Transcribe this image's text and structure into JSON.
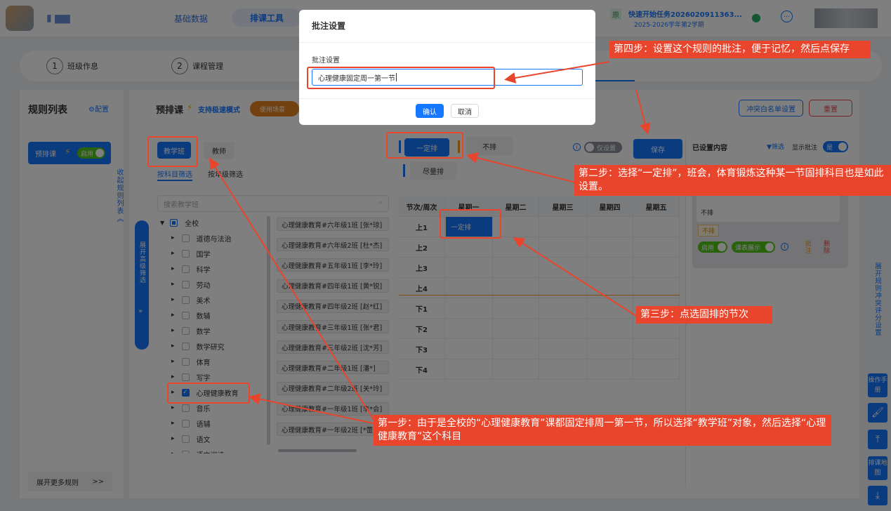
{
  "topnav": {
    "app_name": "▮ ▆▆",
    "tab_basic": "基础数据",
    "tab_schedule": "排课工具",
    "badge_yuan": "原",
    "task_title": "快速开始任务2026020911363...",
    "term": "2025-2026学年第2学期"
  },
  "steps": [
    {
      "num": "1",
      "label": "班级作息"
    },
    {
      "num": "2",
      "label": "课程管理"
    }
  ],
  "sidebar": {
    "title": "规则列表",
    "config": "配置",
    "rule_label": "预排课",
    "rule_toggle": "启用",
    "collapse": "收起规则列表",
    "more_rules": "展开更多规则",
    "more_arrow": ">>"
  },
  "main": {
    "title": "预排课",
    "fast_mode": "支持极速模式",
    "usage_scene": "使用场景",
    "btn_conflict": "冲突白名单设置",
    "btn_reset": "重置",
    "btn_class": "教学班",
    "btn_teacher": "教师",
    "tab_subject": "按科目筛选",
    "tab_grade": "按年级筛选",
    "search_placeholder": "搜索教学班",
    "expand_filter": "展开高级筛选",
    "root_label": "全校",
    "subjects": [
      "道德与法治",
      "国学",
      "科学",
      "劳动",
      "美术",
      "数辅",
      "数学",
      "数学研究",
      "体育",
      "写字",
      "心理健康教育",
      "音乐",
      "语辅",
      "语文",
      "语文阅读"
    ],
    "classes": [
      "心理健康教育#六年级1班 [张*琼]",
      "心理健康教育#六年级2班 [杜*杰]",
      "心理健康教育#五年级1班 [李*玲]",
      "心理健康教育#四年级1班 [黄*锐]",
      "心理健康教育#四年级2班 [赵*红]",
      "心理健康教育#三年级1班 [张*君]",
      "心理健康教育#三年级2班 [沈*芳]",
      "心理健康教育#二年级1班 [潘*]",
      "心理健康教育#二年级2班 [关*玲]",
      "心理健康教育#一年级1班 [李*会]",
      "心理健康教育#一年级2班 [*蕾]"
    ],
    "opt_fixed": "一定排",
    "opt_no": "不排",
    "opt_try": "尽量排",
    "only_set": "仅设置",
    "save": "保存",
    "grid_corner": "节次/周次",
    "weekdays": [
      "星期一",
      "星期二",
      "星期三",
      "星期四",
      "星期五"
    ],
    "periods": [
      "上1",
      "上2",
      "上3",
      "上4",
      "下1",
      "下2",
      "下3",
      "下4"
    ],
    "cell_value": "一定排",
    "set_content": "已设置内容",
    "filter": "筛选",
    "show_note": "显示批注",
    "show_note_toggle": "是",
    "card_text": "不排",
    "card_tag": "不排",
    "card_enable": "启用",
    "card_display": "课表展示",
    "card_note": "批注",
    "card_delete": "删除"
  },
  "rightbar": {
    "expand_conflict": "展开规则冲突评分设置",
    "manual": "操作手册",
    "map": "排课地图"
  },
  "modal": {
    "title": "批注设置",
    "field_label": "批注设置",
    "value": "心理健康固定周一第一节",
    "ok": "确认",
    "cancel": "取消"
  },
  "callouts": {
    "step1": "第一步：由于是全校的“心理健康教育”课都固定排周一第一节，所以选择“教学班”对象，然后选择“心理健康教育”这个科目",
    "step2": "第二步：选择“一定排”，班会，体育锻炼这种某一节固排科目也是如此设置。",
    "step3": "第三步：点选固排的节次",
    "step4": "第四步：设置这个规则的批注，便于记忆，然后点保存"
  },
  "colors": {
    "accent": "#1677ff",
    "callout": "#e8452c",
    "orange": "#f39c12"
  }
}
